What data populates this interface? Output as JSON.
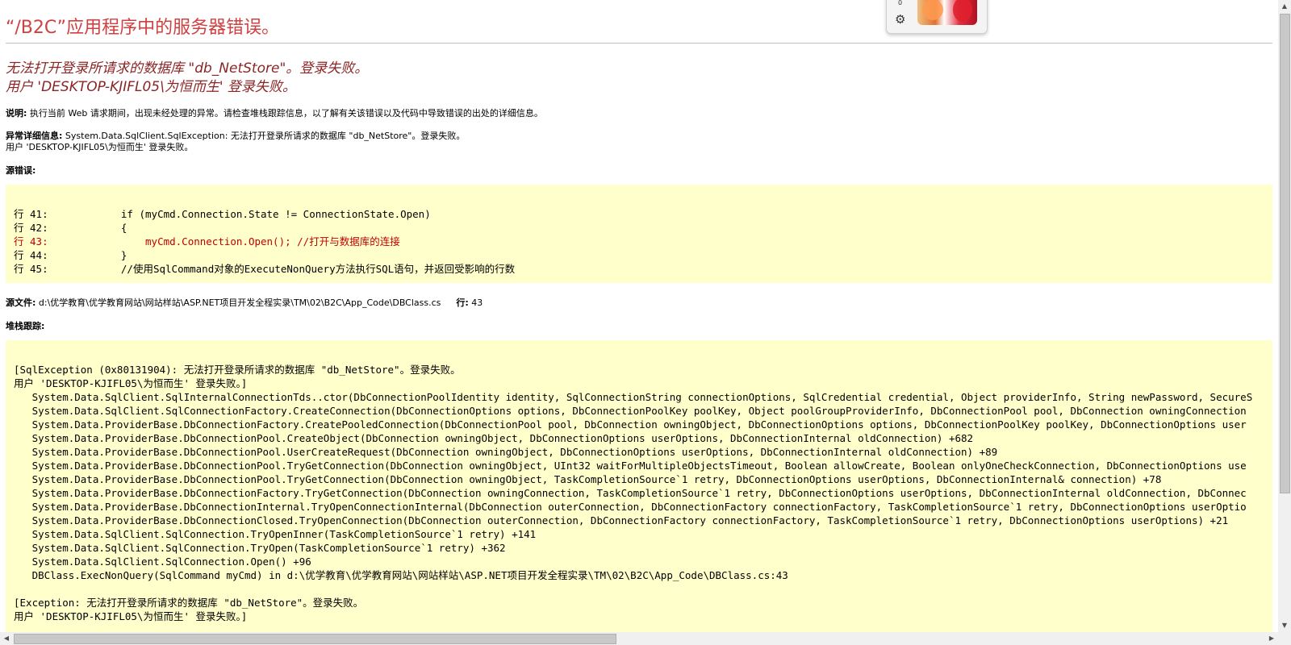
{
  "page": {
    "title": "“/B2C”应用程序中的服务器错误。",
    "error_lines": [
      "无法打开登录所请求的数据库 \"db_NetStore\"。登录失败。",
      "用户 'DESKTOP-KJIFL05\\为恒而生' 登录失败。"
    ],
    "description": {
      "label": "说明:",
      "text": "执行当前 Web 请求期间，出现未经处理的异常。请检查堆栈跟踪信息，以了解有关该错误以及代码中导致错误的出处的详细信息。"
    },
    "exception_details": {
      "label": "异常详细信息:",
      "line1": "System.Data.SqlClient.SqlException: 无法打开登录所请求的数据库 \"db_NetStore\"。登录失败。",
      "line2": "用户 'DESKTOP-KJIFL05\\为恒而生' 登录失败。"
    },
    "source_error_label": "源错误:",
    "source_lines": [
      {
        "text": "行 41:            if (myCmd.Connection.State != ConnectionState.Open)",
        "highlight": false
      },
      {
        "text": "行 42:            {",
        "highlight": false
      },
      {
        "text": "行 43:                myCmd.Connection.Open(); //打开与数据库的连接",
        "highlight": true
      },
      {
        "text": "行 44:            }",
        "highlight": false
      },
      {
        "text": "行 45:            //使用SqlCommand对象的ExecuteNonQuery方法执行SQL语句，并返回受影响的行数",
        "highlight": false
      }
    ],
    "source_file": {
      "label": "源文件:",
      "path": "d:\\优学教育\\优学教育网站\\网站样站\\ASP.NET项目开发全程实录\\TM\\02\\B2C\\App_Code\\DBClass.cs",
      "line_label": "行:",
      "line_value": "43"
    },
    "stack_trace_label": "堆栈跟踪:",
    "stack_lines": [
      "[SqlException (0x80131904): 无法打开登录所请求的数据库 \"db_NetStore\"。登录失败。",
      "用户 'DESKTOP-KJIFL05\\为恒而生' 登录失败。]",
      "   System.Data.SqlClient.SqlInternalConnectionTds..ctor(DbConnectionPoolIdentity identity, SqlConnectionString connectionOptions, SqlCredential credential, Object providerInfo, String newPassword, SecureS",
      "   System.Data.SqlClient.SqlConnectionFactory.CreateConnection(DbConnectionOptions options, DbConnectionPoolKey poolKey, Object poolGroupProviderInfo, DbConnectionPool pool, DbConnection owningConnection",
      "   System.Data.ProviderBase.DbConnectionFactory.CreatePooledConnection(DbConnectionPool pool, DbConnection owningObject, DbConnectionOptions options, DbConnectionPoolKey poolKey, DbConnectionOptions user",
      "   System.Data.ProviderBase.DbConnectionPool.CreateObject(DbConnection owningObject, DbConnectionOptions userOptions, DbConnectionInternal oldConnection) +682",
      "   System.Data.ProviderBase.DbConnectionPool.UserCreateRequest(DbConnection owningObject, DbConnectionOptions userOptions, DbConnectionInternal oldConnection) +89",
      "   System.Data.ProviderBase.DbConnectionPool.TryGetConnection(DbConnection owningObject, UInt32 waitForMultipleObjectsTimeout, Boolean allowCreate, Boolean onlyOneCheckConnection, DbConnectionOptions use",
      "   System.Data.ProviderBase.DbConnectionPool.TryGetConnection(DbConnection owningObject, TaskCompletionSource`1 retry, DbConnectionOptions userOptions, DbConnectionInternal& connection) +78",
      "   System.Data.ProviderBase.DbConnectionFactory.TryGetConnection(DbConnection owningConnection, TaskCompletionSource`1 retry, DbConnectionOptions userOptions, DbConnectionInternal oldConnection, DbConnec",
      "   System.Data.ProviderBase.DbConnectionInternal.TryOpenConnectionInternal(DbConnection outerConnection, DbConnectionFactory connectionFactory, TaskCompletionSource`1 retry, DbConnectionOptions userOptio",
      "   System.Data.ProviderBase.DbConnectionClosed.TryOpenConnection(DbConnection outerConnection, DbConnectionFactory connectionFactory, TaskCompletionSource`1 retry, DbConnectionOptions userOptions) +21",
      "   System.Data.SqlClient.SqlConnection.TryOpenInner(TaskCompletionSource`1 retry) +141",
      "   System.Data.SqlClient.SqlConnection.TryOpen(TaskCompletionSource`1 retry) +362",
      "   System.Data.SqlClient.SqlConnection.Open() +96",
      "   DBClass.ExecNonQuery(SqlCommand myCmd) in d:\\优学教育\\优学教育网站\\网站样站\\ASP.NET项目开发全程实录\\TM\\02\\B2C\\App_Code\\DBClass.cs:43",
      "",
      "[Exception: 无法打开登录所请求的数据库 \"db_NetStore\"。登录失败。",
      "用户 'DESKTOP-KJIFL05\\为恒而生' 登录失败。]"
    ]
  },
  "flyout": {
    "counter": "0",
    "settings_icon": "gear-icon"
  },
  "icons": {
    "up": "▲",
    "down": "▼",
    "left": "◀",
    "right": "▶",
    "gear": "⚙"
  }
}
